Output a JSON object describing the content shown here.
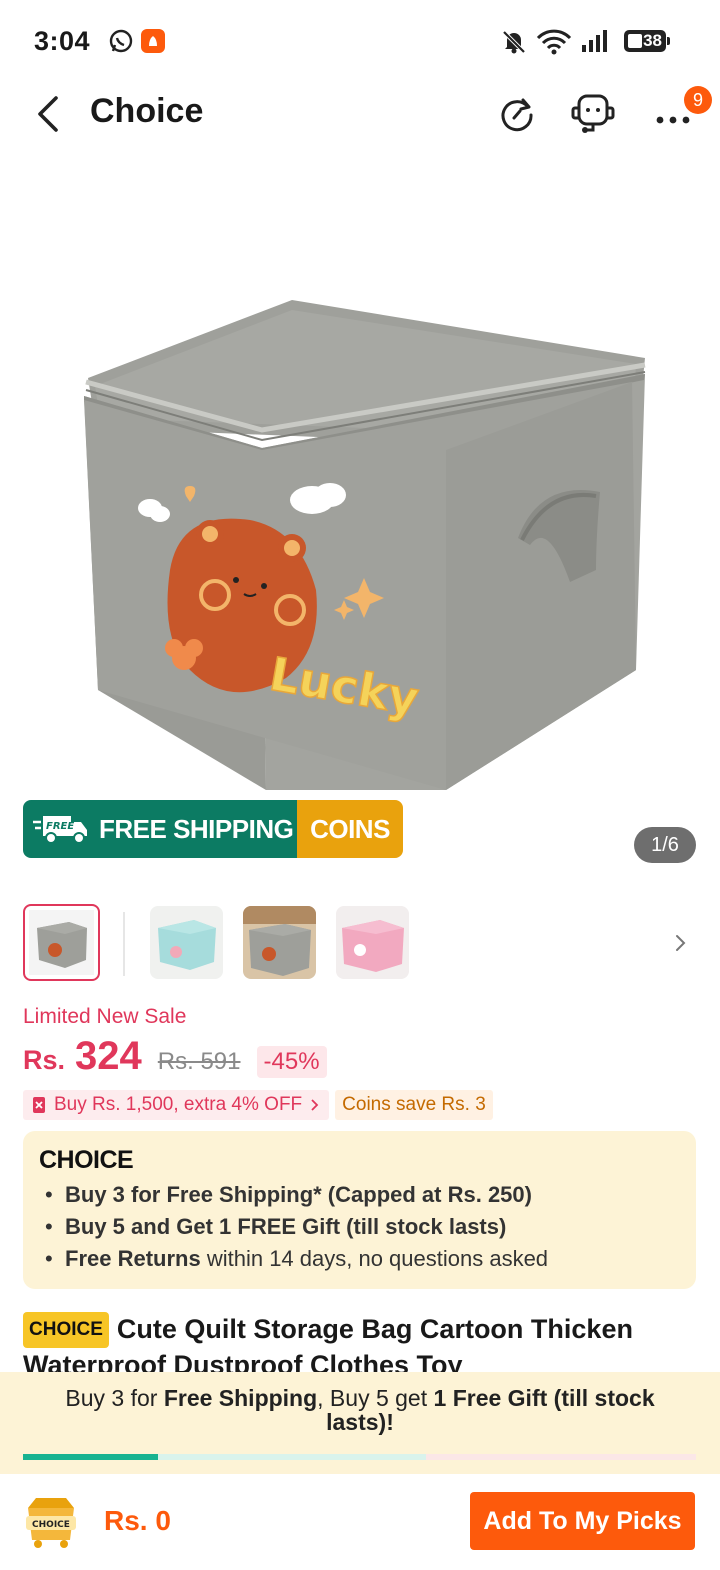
{
  "status_bar": {
    "time": "3:04",
    "battery": "38",
    "icons": [
      "whatsapp-icon",
      "app-notification-icon",
      "mute-icon",
      "wifi-icon",
      "signal-icon",
      "battery-icon"
    ]
  },
  "header": {
    "title": "Choice",
    "more_badge": "9",
    "icons": [
      "back-arrow-icon",
      "share-refresh-icon",
      "support-agent-icon",
      "more-dots-icon"
    ]
  },
  "gallery": {
    "page_indicator": "1/6",
    "thumbnails": [
      {
        "name": "gray-box",
        "active": true
      },
      {
        "name": "blue-box",
        "active": false
      },
      {
        "name": "gray-box-room",
        "active": false
      },
      {
        "name": "pink-box",
        "active": false
      }
    ]
  },
  "promo_banner": {
    "free_badge": "FREE",
    "shipping_label": "FREE SHIPPING",
    "coins_label": "COINS",
    "colors": {
      "shipping": "#0c7b63",
      "coins": "#e9a20d"
    }
  },
  "price": {
    "sale_label": "Limited New Sale",
    "currency": "Rs.",
    "current": "324",
    "original": "Rs. 591",
    "discount": "-45%",
    "coupon_tag": "Buy Rs. 1,500, extra 4% OFF",
    "coins_tag": "Coins save Rs. 3",
    "accent": "#e0375b"
  },
  "choice_card": {
    "logo": "CHOICE",
    "items": [
      {
        "bold": "Buy 3 for  Free Shipping* (Capped at Rs. 250)",
        "rest": ""
      },
      {
        "bold": "Buy 5 and Get 1 FREE Gift (till stock lasts)",
        "rest": ""
      },
      {
        "bold": "Free Returns",
        "rest": " within 14 days, no questions asked"
      }
    ]
  },
  "product": {
    "chip": "CHOICE",
    "title": "Cute Quilt Storage Bag Cartoon Thicken Waterproof Dustproof Clothes Toy"
  },
  "sticky_promo": {
    "part1": "Buy 3 for ",
    "bold1": "Free Shipping",
    "part2": ", Buy 5 get ",
    "bold2": "1 Free Gift (till stock lasts)!",
    "progress": 0.2
  },
  "bottom_bar": {
    "cart_label": "CHOICE",
    "amount": "Rs. 0",
    "add_button": "Add To My Picks",
    "button_color": "#fd5a0c"
  }
}
